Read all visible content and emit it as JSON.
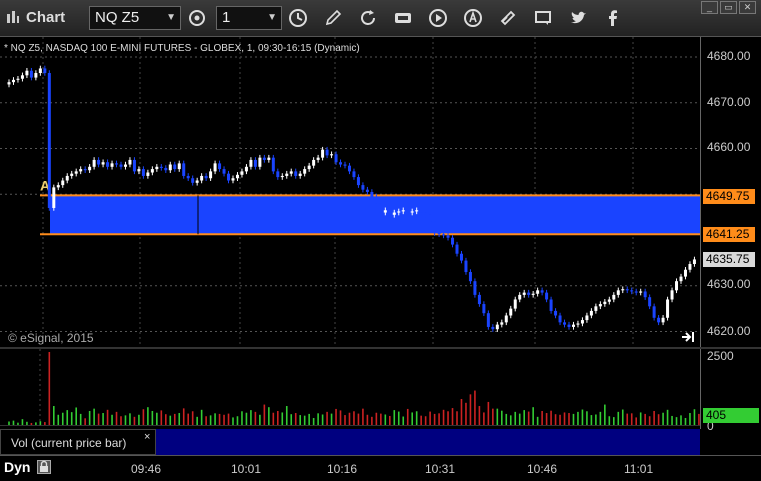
{
  "window": {
    "title": "Chart",
    "min_label": "_",
    "restore_label": "▭",
    "close_label": "✕"
  },
  "toolbar": {
    "symbol": "NQ Z5",
    "interval": "1",
    "icons": [
      "symbol-list-icon",
      "clock-icon",
      "pencil-icon",
      "refresh-icon",
      "get-icon",
      "play-icon",
      "alert-icon",
      "link-icon",
      "chat-icon",
      "twitter-icon",
      "facebook-icon"
    ]
  },
  "chart": {
    "header": "* NQ Z5, NASDAQ 100 E-MINI FUTURES - GLOBEX, 1, 09:30-16:15 (Dynamic)",
    "copyright": "© eSignal, 2015",
    "marker_label": "A",
    "zone_color": "#1a44ff",
    "zone_line_color": "#ff8c1a",
    "up_color": "#ffffff",
    "down_color": "#1a44ff",
    "price_labels": [
      "4680.00",
      "4670.00",
      "4660.00",
      "4650.00",
      "4640.00",
      "4630.00",
      "4620.00"
    ],
    "tag_upper": "4649.75",
    "tag_lower": "4641.25",
    "tag_last": "4635.75"
  },
  "volume": {
    "axis_top": "2500",
    "axis_bottom": "0",
    "last_volume": "405",
    "legend_label": "Vol (current price bar)",
    "legend_close": "×",
    "up_color": "#33cc33",
    "down_color": "#cc2222"
  },
  "time_axis": {
    "mode": "Dyn",
    "labels": [
      "09:46",
      "10:01",
      "10:16",
      "10:31",
      "10:46",
      "11:01"
    ]
  },
  "chart_data": {
    "type": "candlestick",
    "title": "NQ Z5, NASDAQ 100 E-MINI FUTURES - GLOBEX, 1, 09:30-16:15 (Dynamic)",
    "ylim": [
      4618,
      4684
    ],
    "y_ticks": [
      4620,
      4630,
      4640,
      4650,
      4660,
      4670,
      4680
    ],
    "x_ticks": [
      "09:46",
      "10:01",
      "10:16",
      "10:31",
      "10:46",
      "11:01"
    ],
    "x_range_minutes": [
      "09:30",
      "11:11"
    ],
    "zone": {
      "upper": 4649.75,
      "lower": 4641.25
    },
    "last_price": 4635.75,
    "closes": [
      4674.5,
      4675,
      4675.25,
      4676,
      4677,
      4675.5,
      4676.5,
      4677.5,
      4676.5,
      4647,
      4651.5,
      4652,
      4653,
      4654,
      4654.5,
      4655,
      4655.5,
      4655.25,
      4656,
      4657.5,
      4656.5,
      4657,
      4656,
      4656.75,
      4656.5,
      4656,
      4656.5,
      4657.5,
      4655,
      4655.5,
      4654,
      4654.75,
      4655.5,
      4656,
      4655.75,
      4655.25,
      4656.5,
      4655.5,
      4656.75,
      4654,
      4653.5,
      4652.5,
      4653,
      4654,
      4653.5,
      4655,
      4656.75,
      4655.5,
      4654.5,
      4653,
      4653.5,
      4654.25,
      4655,
      4656,
      4657.5,
      4656,
      4658,
      4657.5,
      4658,
      4655,
      4653.75,
      4654,
      4654.5,
      4655,
      4654,
      4654.5,
      4655.5,
      4656.25,
      4657.5,
      4658,
      4659.75,
      4658.5,
      4658.75,
      4657,
      4656.5,
      4656.25,
      4655,
      4653.75,
      4652,
      4651,
      4650.5,
      4649.5,
      4648,
      4646,
      4646.5,
      4645.5,
      4646,
      4646.25,
      4646.5,
      4646,
      4646.25,
      4646.5,
      4646,
      4645.5,
      4644,
      4641.5,
      4641.25,
      4641,
      4640.5,
      4639,
      4637,
      4635.5,
      4633,
      4631,
      4628,
      4626,
      4624,
      4621,
      4620.5,
      4621.5,
      4622,
      4623.5,
      4625,
      4627,
      4628,
      4628.5,
      4628,
      4628.25,
      4629,
      4628.5,
      4627,
      4624.5,
      4623.5,
      4622,
      4621.5,
      4621,
      4621.5,
      4621.75,
      4622.5,
      4623.5,
      4624.5,
      4625.5,
      4626,
      4626.5,
      4627,
      4628,
      4629,
      4629.25,
      4629,
      4628.75,
      4628.5,
      4628.75,
      4627.5,
      4625.5,
      4623,
      4622,
      4623,
      4627,
      4629,
      4631,
      4632,
      4633.5,
      4634.75,
      4635.75
    ],
    "volume": [
      120,
      150,
      80,
      200,
      110,
      70,
      90,
      130,
      100,
      2500,
      650,
      350,
      420,
      510,
      440,
      600,
      380,
      230,
      480,
      560,
      390,
      410,
      520,
      350,
      450,
      300,
      330,
      400,
      280,
      350,
      540,
      610,
      480,
      420,
      500,
      370,
      320,
      380,
      410,
      570,
      390,
      470,
      280,
      520,
      300,
      330,
      400,
      380,
      350,
      390,
      260,
      300,
      470,
      420,
      510,
      450,
      350,
      700,
      610,
      420,
      480,
      430,
      650,
      370,
      410,
      340,
      320,
      380,
      240,
      400,
      360,
      450,
      390,
      550,
      500,
      340,
      420,
      470,
      390,
      560,
      350,
      280,
      420,
      390,
      360,
      310,
      510,
      460,
      290,
      550,
      430,
      470,
      320,
      300,
      460,
      380,
      400,
      520,
      470,
      580,
      470,
      890,
      760,
      1050,
      1180,
      650,
      430,
      790,
      560,
      560,
      490,
      380,
      330,
      450,
      390,
      510,
      460,
      610,
      280,
      480,
      410,
      490,
      370,
      350,
      430,
      410,
      380,
      450,
      530,
      470,
      340,
      360,
      450,
      700,
      300,
      270,
      450,
      530,
      390,
      400,
      260,
      430,
      380,
      300,
      480,
      370,
      420,
      520,
      310,
      270,
      330,
      240,
      410,
      540,
      380
    ]
  }
}
